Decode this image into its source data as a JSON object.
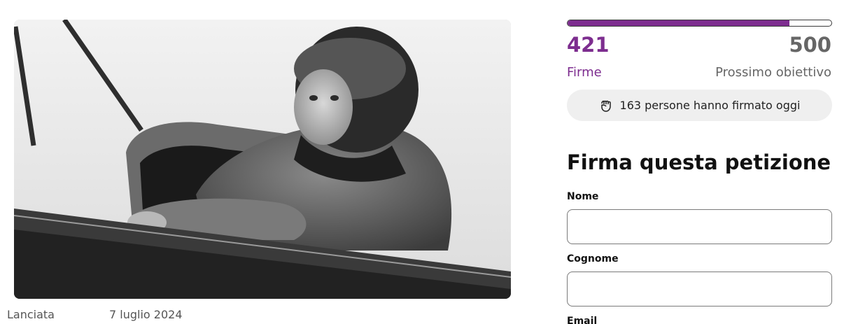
{
  "petition": {
    "launched_label": "Lanciata",
    "launched_date": "7 luglio 2024"
  },
  "signatures": {
    "count": "421",
    "count_label": "Firme",
    "goal": "500",
    "goal_label": "Prossimo obiettivo",
    "progress_fraction": 0.842,
    "accent_color": "#7d2d8f",
    "today_icon": "raised-fist-icon",
    "today_text": "163 persone hanno firmato oggi"
  },
  "form": {
    "title": "Firma questa petizione",
    "first_name_label": "Nome",
    "first_name_value": "",
    "last_name_label": "Cognome",
    "last_name_value": "",
    "email_label": "Email"
  }
}
